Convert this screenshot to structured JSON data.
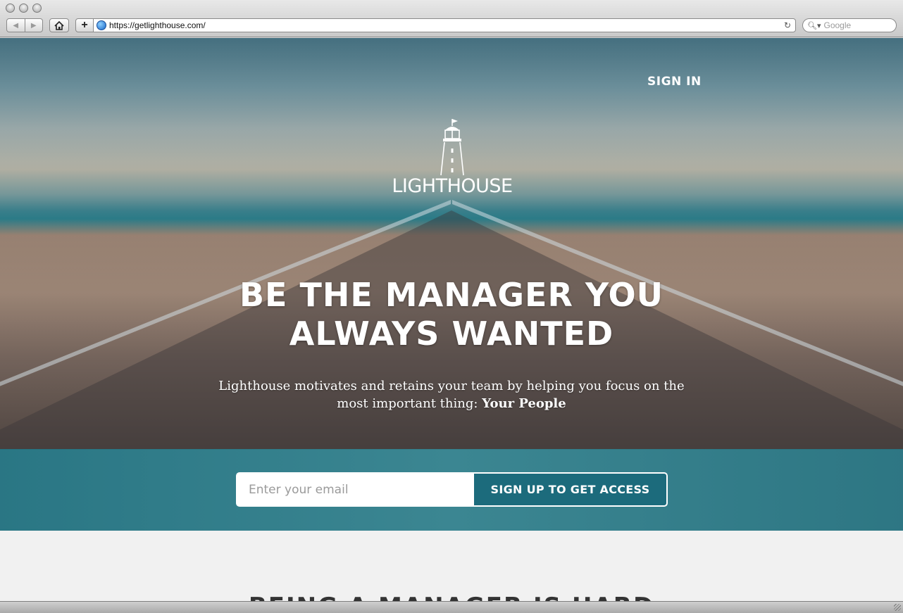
{
  "browser": {
    "url": "https://getlighthouse.com/",
    "search_placeholder": "Google"
  },
  "header": {
    "signin_label": "SIGN IN",
    "logo_text": "LIGHTHOUSE"
  },
  "hero": {
    "headline_line1": "BE THE MANAGER YOU",
    "headline_line2": "ALWAYS WANTED",
    "subhead_line1": "Lighthouse motivates and retains your team by helping you focus on the",
    "subhead_line2_prefix": "most important thing:",
    "subhead_emphasis": "Your People"
  },
  "signup": {
    "email_placeholder": "Enter your email",
    "button_label": "SIGN UP TO GET ACCESS"
  },
  "lower": {
    "section_title": "BEING A MANAGER IS HARD"
  },
  "colors": {
    "band": "#1c6b7c",
    "button": "#1c6b7c",
    "lower_bg": "#f1f1f1"
  }
}
